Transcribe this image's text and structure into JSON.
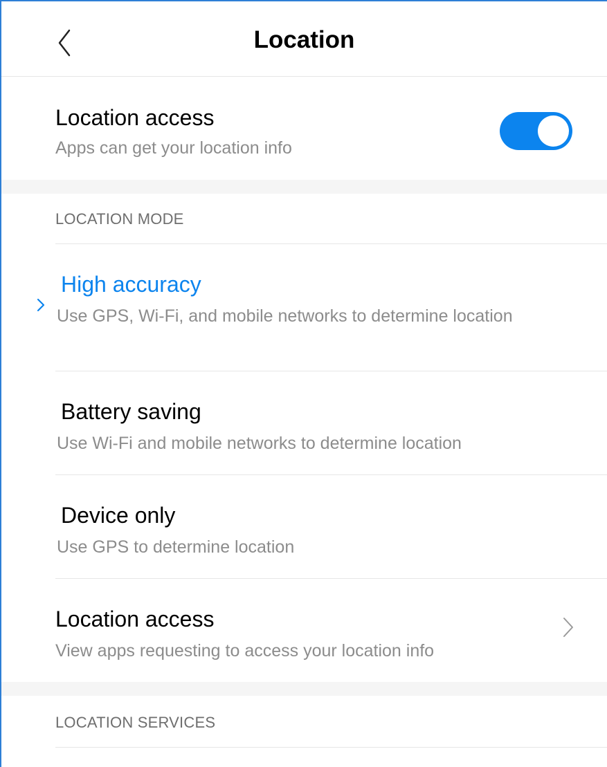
{
  "header": {
    "title": "Location"
  },
  "location_access": {
    "title": "Location access",
    "subtitle": "Apps can get your location info",
    "toggle_on": true
  },
  "location_mode": {
    "section_label": "LOCATION MODE",
    "options": [
      {
        "title": "High accuracy",
        "subtitle": "Use GPS, Wi-Fi, and mobile networks to determine location",
        "selected": true
      },
      {
        "title": "Battery saving",
        "subtitle": "Use Wi-Fi and mobile networks to determine location",
        "selected": false
      },
      {
        "title": "Device only",
        "subtitle": "Use GPS to determine location",
        "selected": false
      }
    ],
    "app_access": {
      "title": "Location access",
      "subtitle": "View apps requesting to access your location info"
    }
  },
  "location_services": {
    "section_label": "LOCATION SERVICES"
  },
  "colors": {
    "accent": "#0c84ee",
    "frame_border": "#2e7fd6",
    "secondary_text": "#8c8c8c",
    "section_band": "#f5f5f5"
  },
  "icons": {
    "back": "back-arrow-icon",
    "selected": "chevron-right-icon",
    "navigate": "chevron-right-icon"
  }
}
